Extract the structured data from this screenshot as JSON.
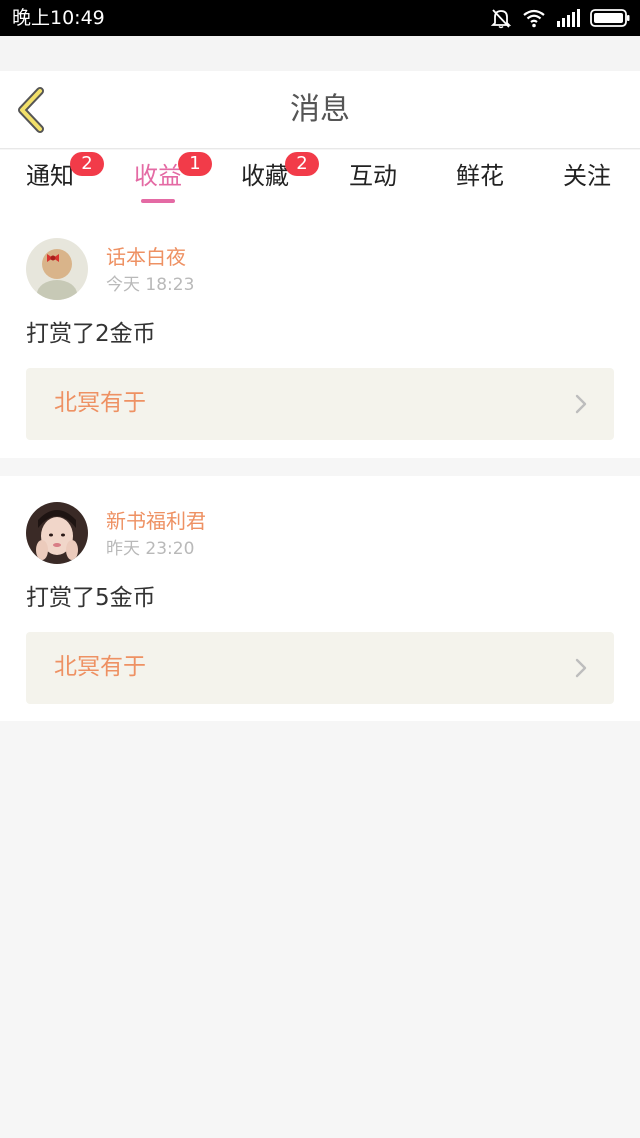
{
  "status_bar": {
    "time": "晚上10:49",
    "icons": [
      "bell-muted-icon",
      "wifi-icon",
      "signal-icon",
      "battery-icon"
    ]
  },
  "header": {
    "title": "消息",
    "back_icon": "chevron-left-icon"
  },
  "tabs": [
    {
      "label": "通知",
      "badge": "2",
      "active": false
    },
    {
      "label": "收益",
      "badge": "1",
      "active": true
    },
    {
      "label": "收藏",
      "badge": "2",
      "active": false
    },
    {
      "label": "互动",
      "badge": null,
      "active": false
    },
    {
      "label": "鲜花",
      "badge": null,
      "active": false
    },
    {
      "label": "关注",
      "badge": null,
      "active": false
    }
  ],
  "messages": [
    {
      "user": "话本白夜",
      "time": "今天 18:23",
      "text": "打赏了2金币",
      "book": "北冥有于"
    },
    {
      "user": "新书福利君",
      "time": "昨天 23:20",
      "text": "打赏了5金币",
      "book": "北冥有于"
    }
  ],
  "colors": {
    "accent_pink": "#e46aa4",
    "name_orange": "#ee9163",
    "badge_red": "#f23b49",
    "book_row_bg": "#f4f3ec"
  }
}
